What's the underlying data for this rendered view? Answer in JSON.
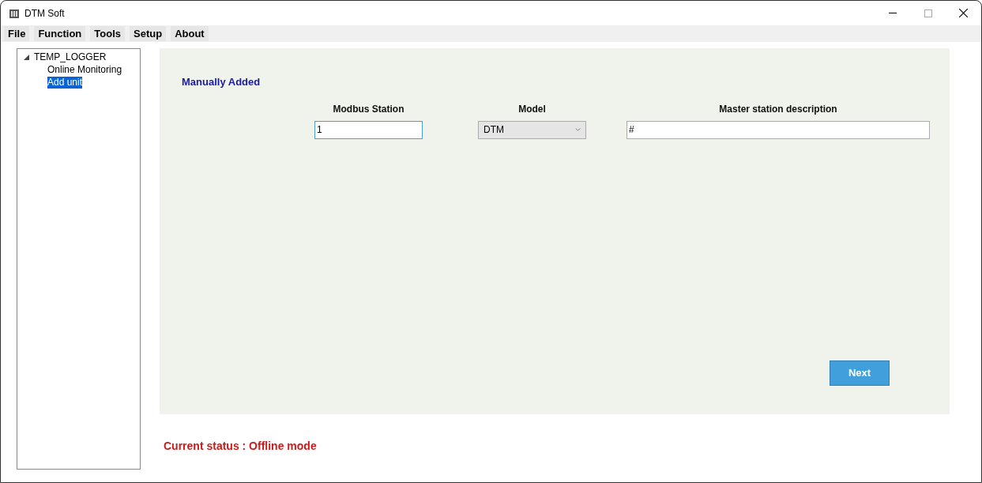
{
  "window": {
    "title": "DTM Soft"
  },
  "menu": [
    {
      "label": "File"
    },
    {
      "label": "Function"
    },
    {
      "label": "Tools"
    },
    {
      "label": "Setup"
    },
    {
      "label": "About"
    }
  ],
  "tree": [
    {
      "label": "TEMP_LOGGER",
      "expanded": true,
      "selected": false,
      "children": [
        {
          "label": "Online Monitoring",
          "selected": false
        },
        {
          "label": "Add unit",
          "selected": true
        }
      ]
    }
  ],
  "form": {
    "heading": "Manually Added",
    "fields": [
      {
        "kind": "text",
        "label": "Modbus Station",
        "value": "1"
      },
      {
        "kind": "select",
        "label": "Model",
        "value": "DTM"
      },
      {
        "kind": "text",
        "label": "Master station description",
        "value": "#"
      }
    ],
    "next_button": "Next"
  },
  "status": "Current status : Offline mode"
}
